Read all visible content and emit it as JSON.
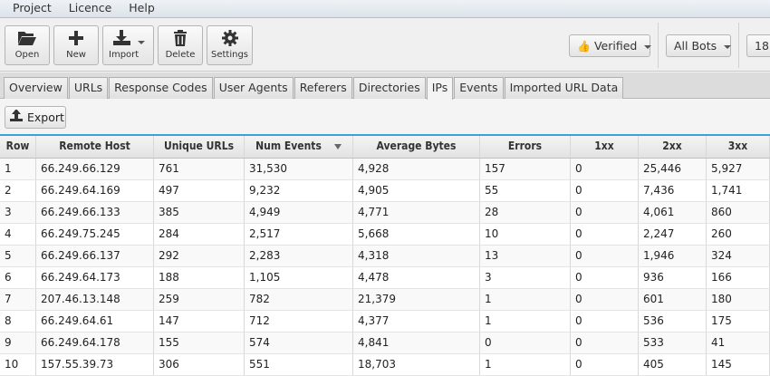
{
  "menu": [
    "Project",
    "Licence",
    "Help"
  ],
  "toolbar": {
    "open": "Open",
    "new": "New",
    "import": "Import",
    "delete": "Delete",
    "settings": "Settings",
    "verified": "Verified",
    "all_bots": "All Bots",
    "truncated": "18"
  },
  "tabs": [
    "Overview",
    "URLs",
    "Response Codes",
    "User Agents",
    "Referers",
    "Directories",
    "IPs",
    "Events",
    "Imported URL Data"
  ],
  "active_tab": "IPs",
  "export_label": "Export",
  "table": {
    "columns": [
      "Row",
      "Remote Host",
      "Unique URLs",
      "Num Events",
      "Average Bytes",
      "Errors",
      "1xx",
      "2xx",
      "3xx"
    ],
    "sort_column": "Num Events",
    "sort_direction": "descending",
    "rows": [
      [
        "1",
        "66.249.66.129",
        "761",
        "31,530",
        "4,928",
        "157",
        "0",
        "25,446",
        "5,927"
      ],
      [
        "2",
        "66.249.64.169",
        "497",
        "9,232",
        "4,905",
        "55",
        "0",
        "7,436",
        "1,741"
      ],
      [
        "3",
        "66.249.66.133",
        "385",
        "4,949",
        "4,771",
        "28",
        "0",
        "4,061",
        "860"
      ],
      [
        "4",
        "66.249.75.245",
        "284",
        "2,517",
        "5,668",
        "10",
        "0",
        "2,247",
        "260"
      ],
      [
        "5",
        "66.249.66.137",
        "292",
        "2,283",
        "4,318",
        "13",
        "0",
        "1,946",
        "324"
      ],
      [
        "6",
        "66.249.64.173",
        "188",
        "1,105",
        "4,478",
        "3",
        "0",
        "936",
        "166"
      ],
      [
        "7",
        "207.46.13.148",
        "259",
        "782",
        "21,379",
        "1",
        "0",
        "601",
        "180"
      ],
      [
        "8",
        "66.249.64.61",
        "147",
        "712",
        "4,377",
        "1",
        "0",
        "536",
        "175"
      ],
      [
        "9",
        "66.249.64.178",
        "155",
        "574",
        "4,841",
        "0",
        "0",
        "533",
        "41"
      ],
      [
        "10",
        "157.55.39.73",
        "306",
        "551",
        "18,703",
        "1",
        "0",
        "405",
        "145"
      ]
    ]
  },
  "colors": {
    "accent": "#3ba2d6"
  }
}
